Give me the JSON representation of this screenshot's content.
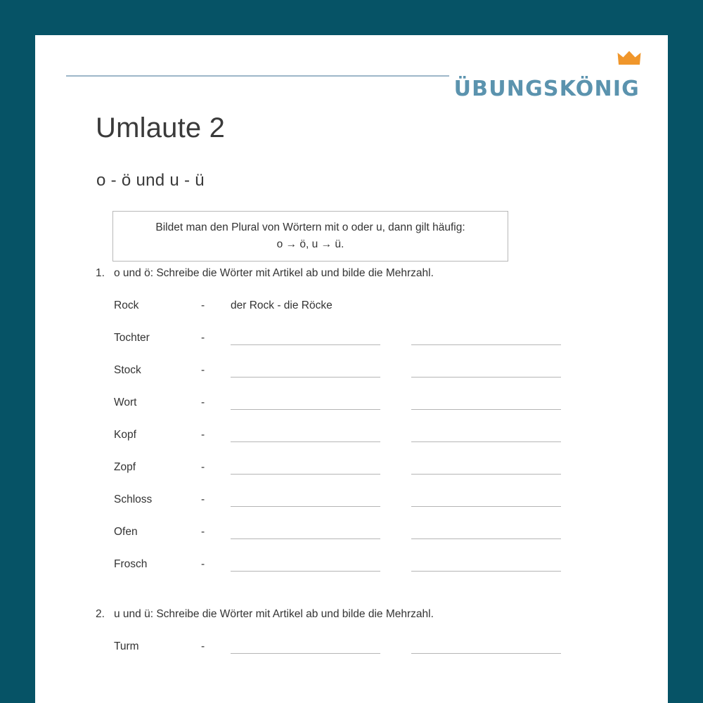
{
  "theme": {
    "background_color": "#065366",
    "page_color": "#ffffff",
    "brand_color": "#5b93ae",
    "crown_color": "#f0962b",
    "rule_color": "#9db7c9",
    "text_color": "#333333",
    "line_color": "#b5b5b5"
  },
  "header": {
    "brand_name": "ÜBUNGSKÖNIG",
    "crown_icon": "crown-icon"
  },
  "title": "Umlaute 2",
  "subtitle": "o - ö und u - ü",
  "info_box": {
    "line1": "Bildet man den Plural von Wörtern mit o oder u, dann gilt häufig:",
    "line2": "o → ö, u → ü."
  },
  "exercises": [
    {
      "number": "1.",
      "instruction": "o und ö: Schreibe die Wörter mit Artikel ab und bilde die Mehrzahl.",
      "rows": [
        {
          "word": "Rock",
          "dash": "-",
          "example": "der Rock - die Röcke",
          "filled": true
        },
        {
          "word": "Tochter",
          "dash": "-",
          "example": "",
          "filled": false
        },
        {
          "word": "Stock",
          "dash": "-",
          "example": "",
          "filled": false
        },
        {
          "word": "Wort",
          "dash": "-",
          "example": "",
          "filled": false
        },
        {
          "word": "Kopf",
          "dash": "-",
          "example": "",
          "filled": false
        },
        {
          "word": "Zopf",
          "dash": "-",
          "example": "",
          "filled": false
        },
        {
          "word": "Schloss",
          "dash": "-",
          "example": "",
          "filled": false
        },
        {
          "word": "Ofen",
          "dash": "-",
          "example": "",
          "filled": false
        },
        {
          "word": "Frosch",
          "dash": "-",
          "example": "",
          "filled": false
        }
      ]
    },
    {
      "number": "2.",
      "instruction": "u und ü: Schreibe die Wörter mit Artikel ab und bilde die Mehrzahl.",
      "rows": [
        {
          "word": "Turm",
          "dash": "-",
          "example": "",
          "filled": false
        }
      ]
    }
  ]
}
